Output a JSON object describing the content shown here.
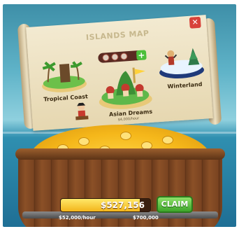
{
  "map": {
    "title": "ISLANDS MAP",
    "close_icon": "close-x-icon",
    "plus_icon": "plus-icon",
    "progress_dots": 3,
    "islands": [
      {
        "name": "Tropical Coast",
        "sub": ""
      },
      {
        "name": "Asian Dreams",
        "sub": "$4,000/hour"
      },
      {
        "name": "Winterland",
        "sub": ""
      }
    ]
  },
  "vault": {
    "value": "$527,156",
    "fill_fraction": 0.88,
    "claim_label": "CLAIM",
    "rate": "$52,000/hour",
    "capacity": "$700,000"
  },
  "colors": {
    "claim_green": "#3da52a",
    "close_red": "#d8423a",
    "coin_gold": "#f5b71a"
  }
}
